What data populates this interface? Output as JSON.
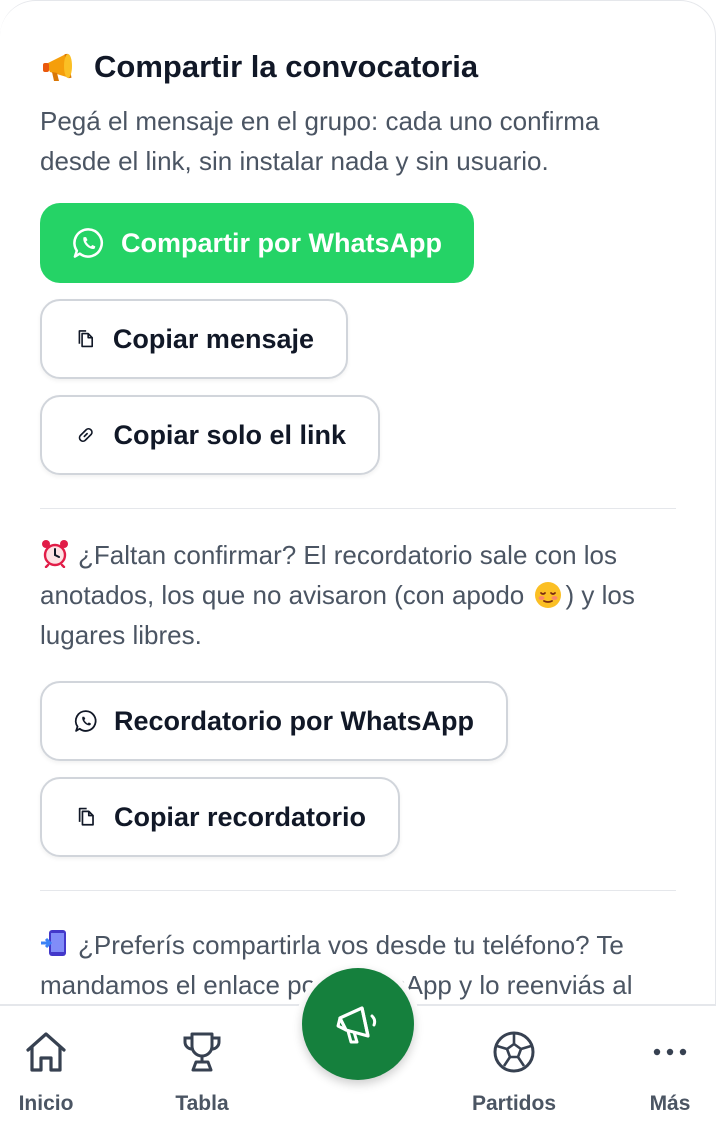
{
  "share": {
    "title": "Compartir la convocatoria",
    "title_icon": "megaphone-icon",
    "description": "Pegá el mensaje en el grupo: cada uno confirma desde el link, sin instalar nada y sin usuario.",
    "whatsapp_label": "Compartir por WhatsApp",
    "copy_message_label": "Copiar mensaje",
    "copy_link_label": "Copiar solo el link",
    "accent_color": "#25d366"
  },
  "reminder": {
    "icon": "alarm-clock-icon",
    "text_before": "¿Faltan confirmar? El recordatorio sale con los anotados, los que no avisaron (con apodo",
    "face_icon": "relieved-face-icon",
    "text_after": ") y los lugares libres.",
    "whatsapp_label": "Recordatorio por WhatsApp",
    "copy_label": "Copiar recordatorio"
  },
  "phone": {
    "icon": "mobile-arrow-icon",
    "text": "¿Preferís compartirla vos desde tu teléfono? Te mandamos el enlace por WhatsApp y lo reenviás al"
  },
  "nav": {
    "home": "Inicio",
    "table": "Tabla",
    "matches": "Partidos",
    "more": "Más",
    "fab_icon": "megaphone-icon",
    "fab_color": "#15803d"
  }
}
